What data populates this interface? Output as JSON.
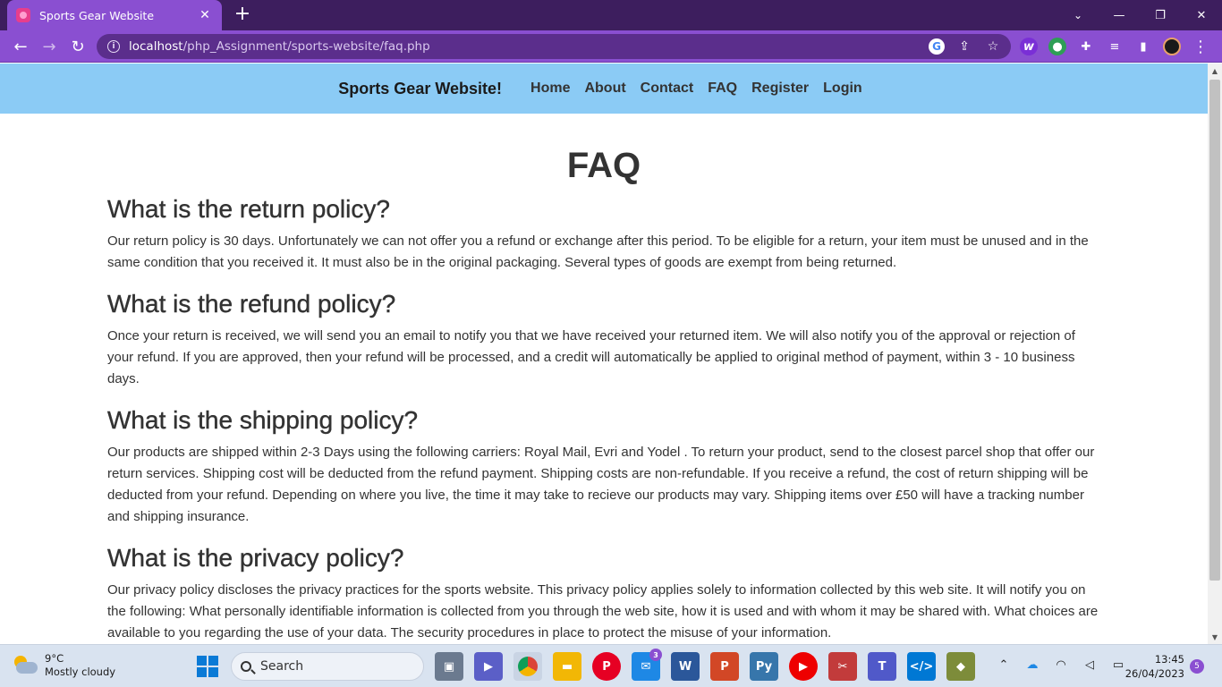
{
  "browser": {
    "tab_title": "Sports Gear Website",
    "url_host": "localhost",
    "url_path": "/php_Assignment/sports-website/faq.php",
    "accent": "#8a4fd1"
  },
  "site": {
    "brand": "Sports Gear Website!",
    "nav": [
      "Home",
      "About",
      "Contact",
      "FAQ",
      "Register",
      "Login"
    ],
    "navbar_color": "#8bcbf5"
  },
  "page": {
    "title": "FAQ",
    "faqs": [
      {
        "question": "What is the return policy?",
        "answer": "Our return policy is 30 days. Unfortunately we can not offer you a refund or exchange after this period. To be eligible for a return, your item must be unused and in the same condition that you received it. It must also be in the original packaging. Several types of goods are exempt from being returned."
      },
      {
        "question": "What is the refund policy?",
        "answer": "Once your return is received, we will send you an email to notify you that we have received your returned item. We will also notify you of the approval or rejection of your refund. If you are approved, then your refund will be processed, and a credit will automatically be applied to original method of payment, within 3 - 10 business days."
      },
      {
        "question": "What is the shipping policy?",
        "answer": "Our products are shipped within 2-3 Days using the following carriers: Royal Mail, Evri and Yodel . To return your product, send to the closest parcel shop that offer our return services. Shipping cost will be deducted from the refund payment. Shipping costs are non-refundable. If you receive a refund, the cost of return shipping will be deducted from your refund. Depending on where you live, the time it may take to recieve our products may vary. Shipping items over £50 will have a tracking number and shipping insurance."
      },
      {
        "question": "What is the privacy policy?",
        "answer": "Our privacy policy discloses the privacy practices for the sports website. This privacy policy applies solely to information collected by this web site. It will notify you on the following: What personally identifiable information is collected from you through the web site, how it is used and with whom it may be shared with. What choices are available to you regarding the use of your data. The security procedures in place to protect the misuse of your information."
      }
    ]
  },
  "taskbar": {
    "temperature": "9°C",
    "weather": "Mostly cloudy",
    "search_label": "Search",
    "mail_badge": "3",
    "time": "13:45",
    "date": "26/04/2023",
    "notifications": "5"
  }
}
